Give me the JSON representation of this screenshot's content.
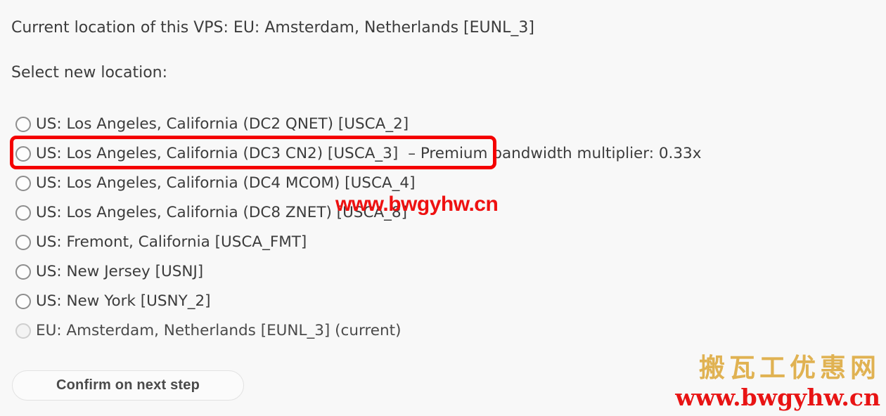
{
  "page": {
    "current_location_line": "Current location of this VPS: EU: Amsterdam, Netherlands [EUNL_3]",
    "select_prompt": "Select new location:"
  },
  "locations": [
    {
      "label": "US: Los Angeles, California (DC2 QNET) [USCA_2]",
      "note": "",
      "selected": false,
      "disabled": false,
      "highlighted": false
    },
    {
      "label": "US: Los Angeles, California (DC3 CN2) [USCA_3]",
      "note": "– Premium bandwidth multiplier: 0.33x",
      "selected": false,
      "disabled": false,
      "highlighted": true
    },
    {
      "label": "US: Los Angeles, California (DC4 MCOM) [USCA_4]",
      "note": "",
      "selected": false,
      "disabled": false,
      "highlighted": false
    },
    {
      "label": "US: Los Angeles, California (DC8 ZNET) [USCA_8]",
      "note": "",
      "selected": false,
      "disabled": false,
      "highlighted": false
    },
    {
      "label": "US: Fremont, California [USCA_FMT]",
      "note": "",
      "selected": false,
      "disabled": false,
      "highlighted": false
    },
    {
      "label": "US: New Jersey [USNJ]",
      "note": "",
      "selected": false,
      "disabled": false,
      "highlighted": false
    },
    {
      "label": "US: New York [USNY_2]",
      "note": "",
      "selected": false,
      "disabled": false,
      "highlighted": false
    },
    {
      "label": "EU: Amsterdam, Netherlands [EUNL_3] (current)",
      "note": "",
      "selected": false,
      "disabled": true,
      "highlighted": false
    }
  ],
  "actions": {
    "confirm_label": "Confirm on next step"
  },
  "watermarks": {
    "inline_url": "www.bwgyhw.cn",
    "corner_brand": "搬瓦工优惠网",
    "corner_url": "www.bwgyhw.cn"
  },
  "colors": {
    "highlight_red": "#f40000",
    "watermark_red": "#e81414",
    "watermark_gold": "#e0b252",
    "text": "#3c3c3c",
    "background": "#f8f8f8"
  }
}
